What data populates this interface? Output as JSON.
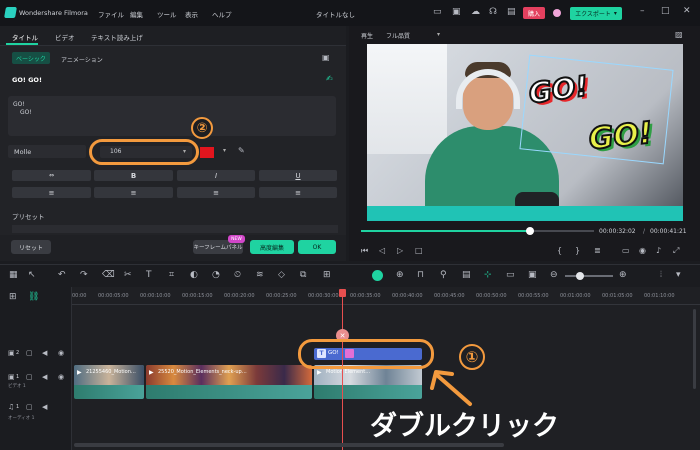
{
  "titlebar": {
    "app_name": "Wondershare Filmora",
    "menus": [
      "ファイル",
      "編集",
      "ツール",
      "表示",
      "ヘルプ"
    ],
    "doc_title": "タイトルなし",
    "buy": "購入",
    "export": "エクスポート"
  },
  "left_panel": {
    "tabs": [
      "タイトル",
      "ビデオ",
      "テキスト読み上げ"
    ],
    "subtabs": [
      "ベーシック",
      "アニメーション"
    ],
    "text_preview": "GO!   GO!",
    "textarea_lines": [
      "GO!",
      "GO!"
    ],
    "font_name": "Molle",
    "font_size": "106",
    "preset_label": "プリセット",
    "reset": "リセット",
    "keyframe": "キーフレームパネル",
    "new_badge": "NEW",
    "advanced": "高度編集",
    "ok": "OK"
  },
  "preview": {
    "play_label": "再生",
    "quality": "フル品質",
    "current_time": "00:00:32:02",
    "separator": "/",
    "total_time": "00:00:41:21",
    "sticker_text": "GO!"
  },
  "timeline": {
    "ruler": [
      "00:00",
      "00:00:05:00",
      "00:00:10:00",
      "00:00:15:00",
      "00:00:20:00",
      "00:00:25:00",
      "00:00:30:00",
      "00:00:35:00",
      "00:00:40:00",
      "00:00:45:00",
      "00:00:50:00",
      "00:00:55:00",
      "00:01:00:00",
      "00:01:05:00",
      "00:01:10:00"
    ],
    "title_clip": "GO!",
    "video_clips": [
      "21255460_Motion…",
      "25520_Motion_Elements_neck-up…",
      "Motion Element…"
    ],
    "track_labels": {
      "t2": "2",
      "t1": "1",
      "video": "ビデオ 1",
      "audio": "オーディオ 1",
      "a1": "1"
    }
  },
  "annotations": {
    "step1": "①",
    "step2": "②",
    "caption": "ダブルクリック"
  },
  "colors": {
    "accent": "#1fd3a1",
    "orange": "#f39a3e",
    "clip_blue": "#4a6ad0",
    "playhead": "#e74f4f"
  }
}
